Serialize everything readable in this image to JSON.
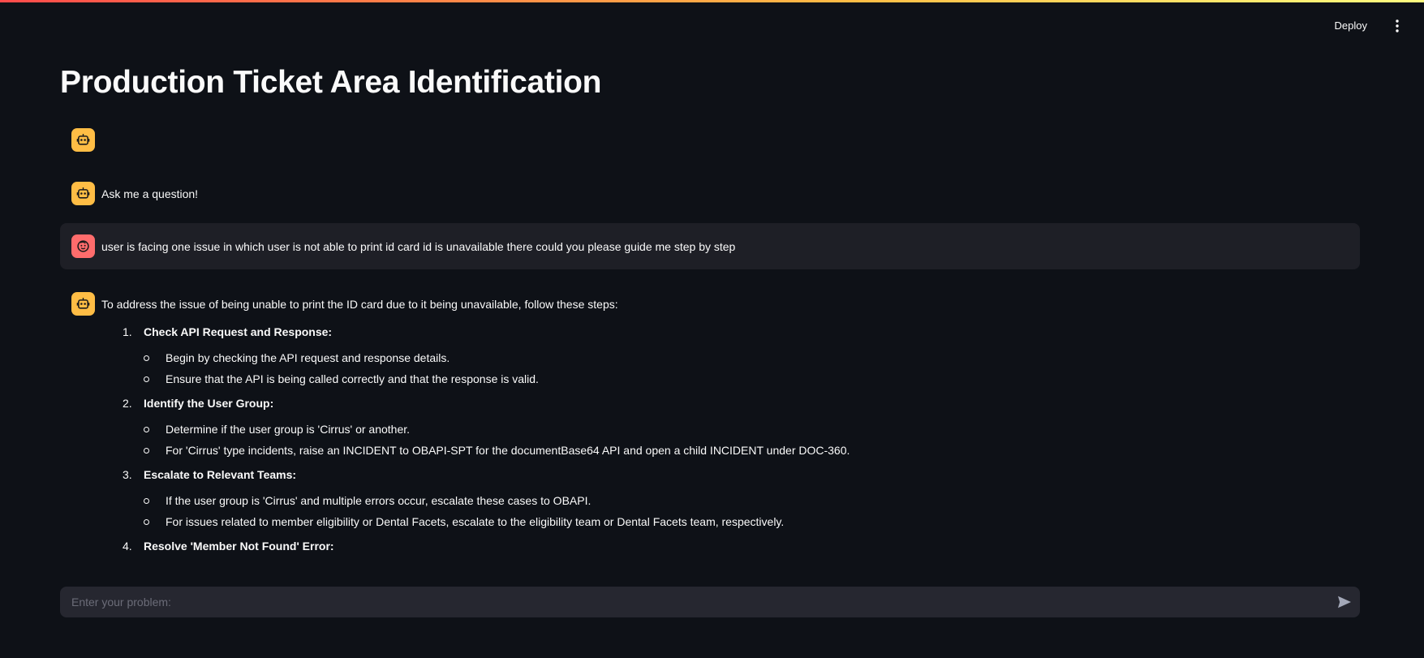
{
  "header": {
    "deploy_label": "Deploy",
    "menu_icon": "kebab-vertical-icon"
  },
  "page": {
    "title": "Production Ticket Area Identification"
  },
  "chat": {
    "messages": [
      {
        "role": "assistant",
        "avatar": "bot-icon",
        "text": ""
      },
      {
        "role": "assistant",
        "avatar": "bot-icon",
        "text": "Ask me a question!"
      },
      {
        "role": "user",
        "avatar": "face-icon",
        "text": "user is facing one issue in which user is not able to print id card id is unavailable there could you please guide me step by step"
      },
      {
        "role": "assistant",
        "avatar": "bot-icon",
        "intro": "To address the issue of being unable to print the ID card due to it being unavailable, follow these steps:",
        "steps": [
          {
            "num": "1.",
            "title": "Check API Request and Response:",
            "bullets": [
              "Begin by checking the API request and response details.",
              "Ensure that the API is being called correctly and that the response is valid."
            ]
          },
          {
            "num": "2.",
            "title": "Identify the User Group:",
            "bullets": [
              "Determine if the user group is 'Cirrus' or another.",
              "For 'Cirrus' type incidents, raise an INCIDENT to OBAPI-SPT for the documentBase64 API and open a child INCIDENT under DOC-360."
            ]
          },
          {
            "num": "3.",
            "title": "Escalate to Relevant Teams:",
            "bullets": [
              "If the user group is 'Cirrus' and multiple errors occur, escalate these cases to OBAPI.",
              "For issues related to member eligibility or Dental Facets, escalate to the eligibility team or Dental Facets team, respectively."
            ]
          },
          {
            "num": "4.",
            "title": "Resolve 'Member Not Found' Error:",
            "bullets": []
          }
        ]
      }
    ]
  },
  "input": {
    "placeholder": "Enter your problem:",
    "value": "",
    "send_icon": "send-icon"
  },
  "colors": {
    "background": "#0e1117",
    "bot_avatar": "#ffbd45",
    "user_avatar": "#ff6c6c",
    "user_bubble": "#1e1f26",
    "input_bg": "#262730"
  }
}
